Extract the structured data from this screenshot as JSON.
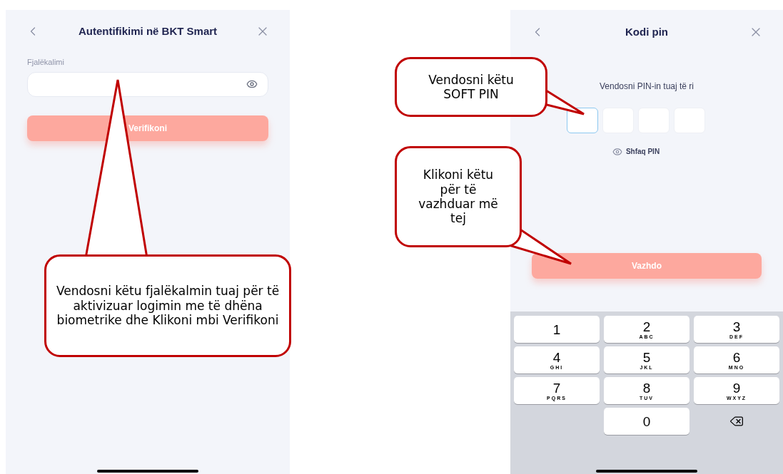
{
  "login_screen": {
    "title": "Autentifikimi në BKT Smart",
    "password_label": "Fjalëkalimi",
    "verify_button": "Verifikoni"
  },
  "login_callout": {
    "text": "Vendosni këtu fjalëkalmin tuaj për të aktivizuar logimin me të dhëna biometrike dhe Klikoni mbi Verifikoni"
  },
  "pin_screen": {
    "title": "Kodi pin",
    "prompt": "Vendosni PIN-in tuaj të ri",
    "pin_boxes": [
      {
        "selected": true
      },
      {
        "selected": false
      },
      {
        "selected": false
      },
      {
        "selected": false
      }
    ],
    "show_pin": "Shfaq PIN",
    "continue_button": "Vazhdo",
    "keypad": [
      {
        "kind": "digit",
        "digit": "1"
      },
      {
        "kind": "digit",
        "digit": "2",
        "letters": "ABC"
      },
      {
        "kind": "digit",
        "digit": "3",
        "letters": "DEF"
      },
      {
        "kind": "digit",
        "digit": "4",
        "letters": "GHI"
      },
      {
        "kind": "digit",
        "digit": "5",
        "letters": "JKL"
      },
      {
        "kind": "digit",
        "digit": "6",
        "letters": "MNO"
      },
      {
        "kind": "digit",
        "digit": "7",
        "letters": "PQRS"
      },
      {
        "kind": "digit",
        "digit": "8",
        "letters": "TUV"
      },
      {
        "kind": "digit",
        "digit": "9",
        "letters": "WXYZ"
      },
      {
        "kind": "blank"
      },
      {
        "kind": "digit",
        "digit": "0"
      },
      {
        "kind": "delete"
      }
    ]
  },
  "pin_callouts": [
    {
      "text": "Vendosni këtu SOFT PIN"
    },
    {
      "text": "Klikoni këtu për të vazhduar më tej"
    }
  ]
}
